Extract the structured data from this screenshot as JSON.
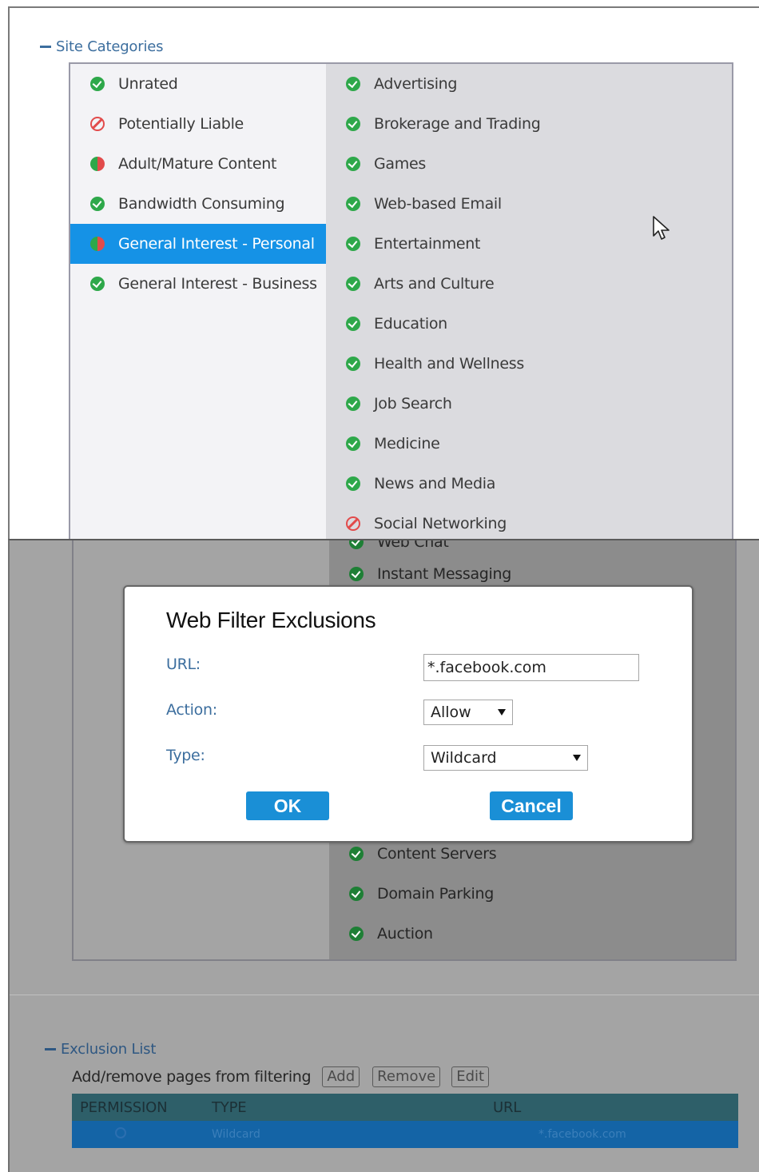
{
  "site_categories": {
    "header": "Site Categories",
    "left_column": [
      {
        "label": "Unrated",
        "status": "allow"
      },
      {
        "label": "Potentially Liable",
        "status": "block"
      },
      {
        "label": "Adult/Mature Content",
        "status": "mixed"
      },
      {
        "label": "Bandwidth Consuming",
        "status": "allow"
      },
      {
        "label": "General Interest - Personal",
        "status": "mixed",
        "selected": true
      },
      {
        "label": "General Interest - Business",
        "status": "allow"
      }
    ],
    "right_column": [
      {
        "label": "Advertising",
        "status": "allow"
      },
      {
        "label": "Brokerage and Trading",
        "status": "allow"
      },
      {
        "label": "Games",
        "status": "allow"
      },
      {
        "label": "Web-based Email",
        "status": "allow"
      },
      {
        "label": "Entertainment",
        "status": "allow"
      },
      {
        "label": "Arts and Culture",
        "status": "allow"
      },
      {
        "label": "Education",
        "status": "allow"
      },
      {
        "label": "Health and Wellness",
        "status": "allow"
      },
      {
        "label": "Job Search",
        "status": "allow"
      },
      {
        "label": "Medicine",
        "status": "allow"
      },
      {
        "label": "News and Media",
        "status": "allow"
      },
      {
        "label": "Social Networking",
        "status": "block"
      }
    ],
    "lower_right_column_top": [
      {
        "label": "Web Chat",
        "status": "allow"
      },
      {
        "label": "Instant Messaging",
        "status": "allow"
      }
    ],
    "lower_right_column_bottom": [
      {
        "label": "Content Servers",
        "status": "allow"
      },
      {
        "label": "Domain Parking",
        "status": "allow"
      },
      {
        "label": "Auction",
        "status": "allow"
      }
    ]
  },
  "dialog": {
    "title": "Web Filter Exclusions",
    "url_label": "URL:",
    "url_value": "*.facebook.com",
    "action_label": "Action:",
    "action_value": "Allow",
    "type_label": "Type:",
    "type_value": "Wildcard",
    "ok_label": "OK",
    "cancel_label": "Cancel"
  },
  "exclusion_list": {
    "header": "Exclusion List",
    "description": "Add/remove pages from filtering",
    "add_label": "Add",
    "remove_label": "Remove",
    "edit_label": "Edit",
    "columns": [
      "PERMISSION",
      "TYPE",
      "URL"
    ],
    "rows": [
      {
        "type": "Wildcard",
        "url": "*.facebook.com"
      }
    ]
  },
  "colors": {
    "allow": "#2ea84a",
    "block": "#e24b4b",
    "selected": "#1592e6",
    "button": "#1a8fd6",
    "table_header": "#2e5f69",
    "table_row_selected": "#1464a6"
  },
  "icons": {
    "allow": "check-circle-icon",
    "block": "block-icon",
    "mixed": "split-status-icon",
    "cursor": "mouse-cursor-icon"
  }
}
